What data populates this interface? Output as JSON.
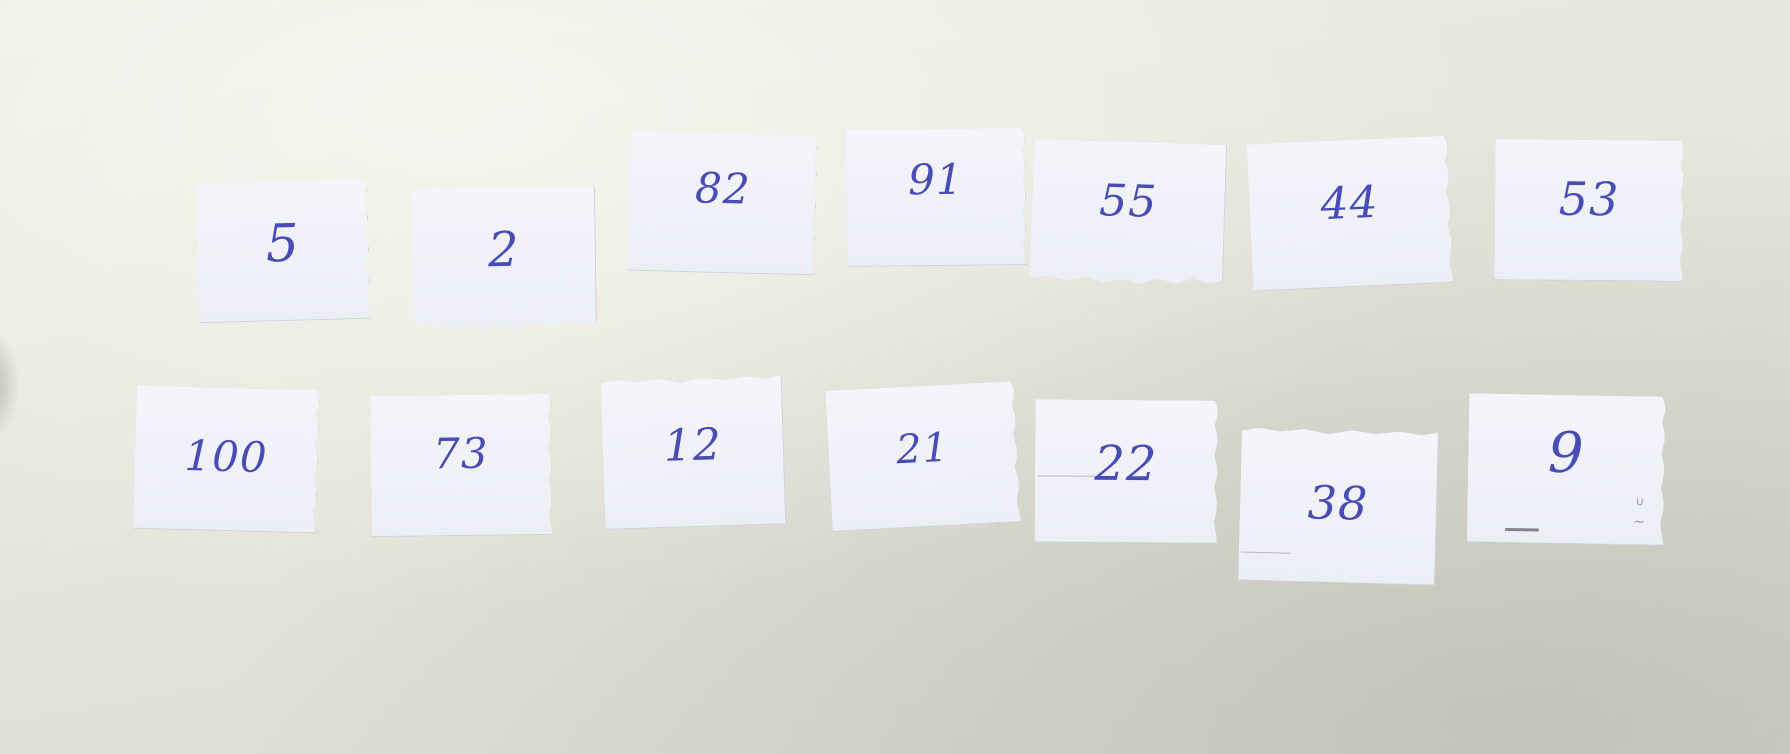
{
  "cards": {
    "row1": [
      {
        "text": "5"
      },
      {
        "text": "2"
      },
      {
        "text": "82"
      },
      {
        "text": "91"
      },
      {
        "text": "55"
      },
      {
        "text": "44"
      },
      {
        "text": "53"
      }
    ],
    "row2": [
      {
        "text": "100"
      },
      {
        "text": "73"
      },
      {
        "text": "12"
      },
      {
        "text": "21"
      },
      {
        "text": "22"
      },
      {
        "text": "38"
      },
      {
        "text": "9"
      }
    ]
  },
  "colors": {
    "ink": "#3a3fb0",
    "paper": "#f0f1f8",
    "table": "#e6e6dd"
  }
}
